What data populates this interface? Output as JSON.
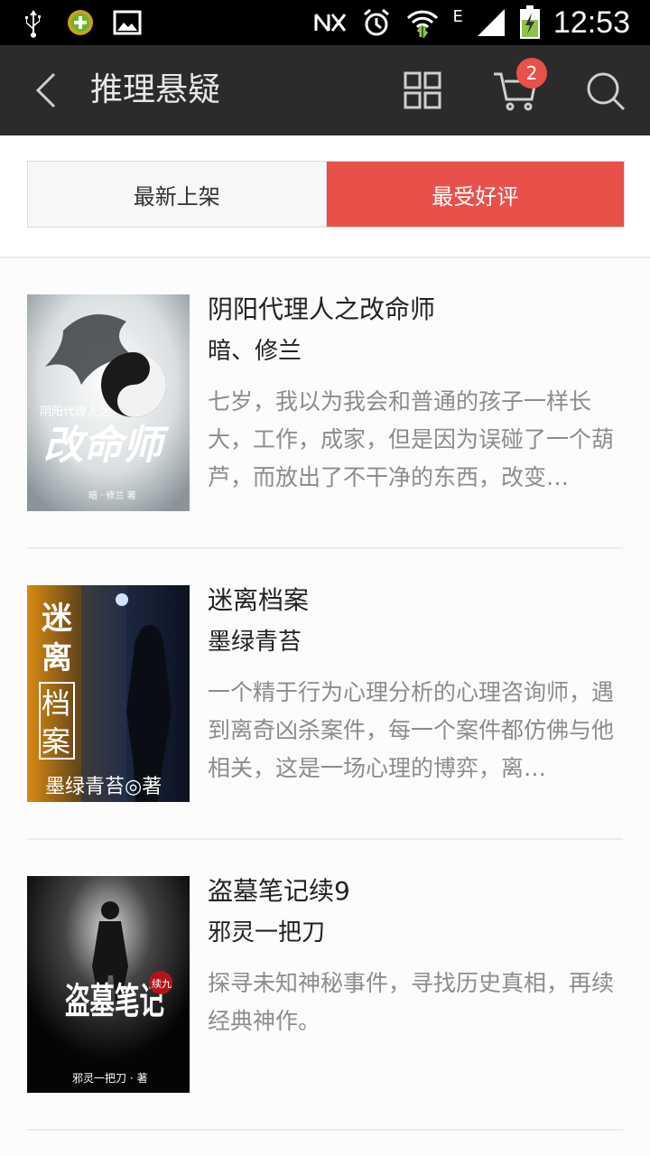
{
  "status_bar": {
    "time": "12:53",
    "left_icons": [
      "usb-icon",
      "app-notification-icon",
      "image-icon"
    ],
    "right_icons": [
      "nfc-icon",
      "alarm-icon",
      "wifi-icon",
      "signal-icon",
      "battery-charging-icon"
    ],
    "network_type": "E"
  },
  "app_bar": {
    "title": "推理悬疑",
    "cart_count": "2"
  },
  "tabs": [
    {
      "label": "最新上架",
      "active": false
    },
    {
      "label": "最受好评",
      "active": true
    }
  ],
  "colors": {
    "accent": "#e8504a",
    "app_bar_bg": "#2b2b2b",
    "desc_text": "#8c8c8c"
  },
  "books": [
    {
      "title": "阴阳代理人之改命师",
      "author": "暗、修兰",
      "description": "七岁，我以为我会和普通的孩子一样长大，工作，成家，但是因为误碰了一个葫芦，而放出了不干净的东西，改变…",
      "cover": {
        "series_text": "阴阳代理人之",
        "title_text": "改命师",
        "author_text": "暗 · 修兰 著"
      }
    },
    {
      "title": "迷离档案",
      "author": "墨绿青苔",
      "description": "一个精于行为心理分析的心理咨询师，遇到离奇凶杀案件，每一个案件都仿佛与他相关，这是一场心理的博弈，离…",
      "cover": {
        "title_chars": [
          "迷",
          "离",
          "档",
          "案"
        ],
        "author_text": "墨绿青苔◎著"
      }
    },
    {
      "title": "盗墓笔记续9",
      "author": "邪灵一把刀",
      "description": "探寻未知神秘事件，寻找历史真相，再续经典神作。",
      "cover": {
        "title_text": "盗墓笔记",
        "badge_text": "续九",
        "author_text": "邪灵一把刀 · 著"
      }
    }
  ]
}
